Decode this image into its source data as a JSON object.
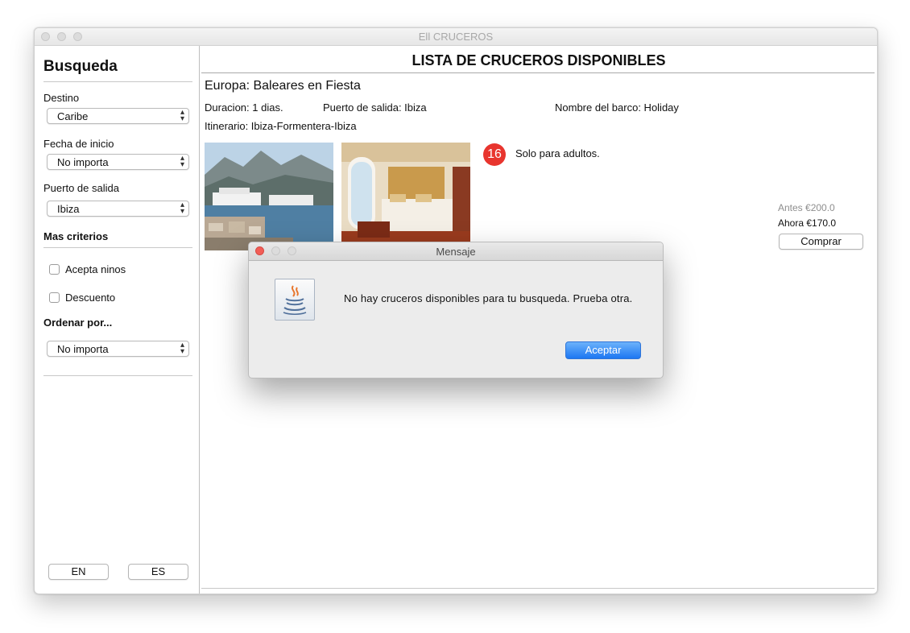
{
  "window": {
    "title": "Ell CRUCEROS"
  },
  "sidebar": {
    "title": "Busqueda",
    "destino": {
      "label": "Destino",
      "value": "Caribe"
    },
    "fecha": {
      "label": "Fecha de inicio",
      "value": "No importa"
    },
    "puerto": {
      "label": "Puerto de salida",
      "value": "Ibiza"
    },
    "mas_criterios": "Mas criterios",
    "acepta_ninos": {
      "label": "Acepta ninos",
      "checked": false
    },
    "descuento": {
      "label": "Descuento",
      "checked": false
    },
    "ordenar": {
      "label": "Ordenar por...",
      "value": "No importa"
    },
    "lang_en": "EN",
    "lang_es": "ES"
  },
  "main": {
    "title": "LISTA DE CRUCEROS DISPONIBLES",
    "cruise": {
      "name": "Europa: Baleares en Fiesta",
      "duracion": "Duracion: 1 dias.",
      "puerto": "Puerto de salida: Ibiza",
      "barco": "Nombre del barco: Holiday",
      "itinerario": "Itinerario: Ibiza-Formentera-Ibiza",
      "age_badge": "16",
      "adults_note": "Solo para adultos.",
      "price_before": "Antes €200.0",
      "price_now": "Ahora €170.0",
      "buy_label": "Comprar"
    }
  },
  "dialog": {
    "title": "Mensaje",
    "message": "No hay cruceros disponibles para tu busqueda. Prueba otra.",
    "ok_label": "Aceptar"
  },
  "colors": {
    "accent": "#1d77f2",
    "badge": "#e8352e"
  },
  "icons": {
    "dialog_icon": "java-icon",
    "select_chevron": "updown-chevron-icon"
  }
}
